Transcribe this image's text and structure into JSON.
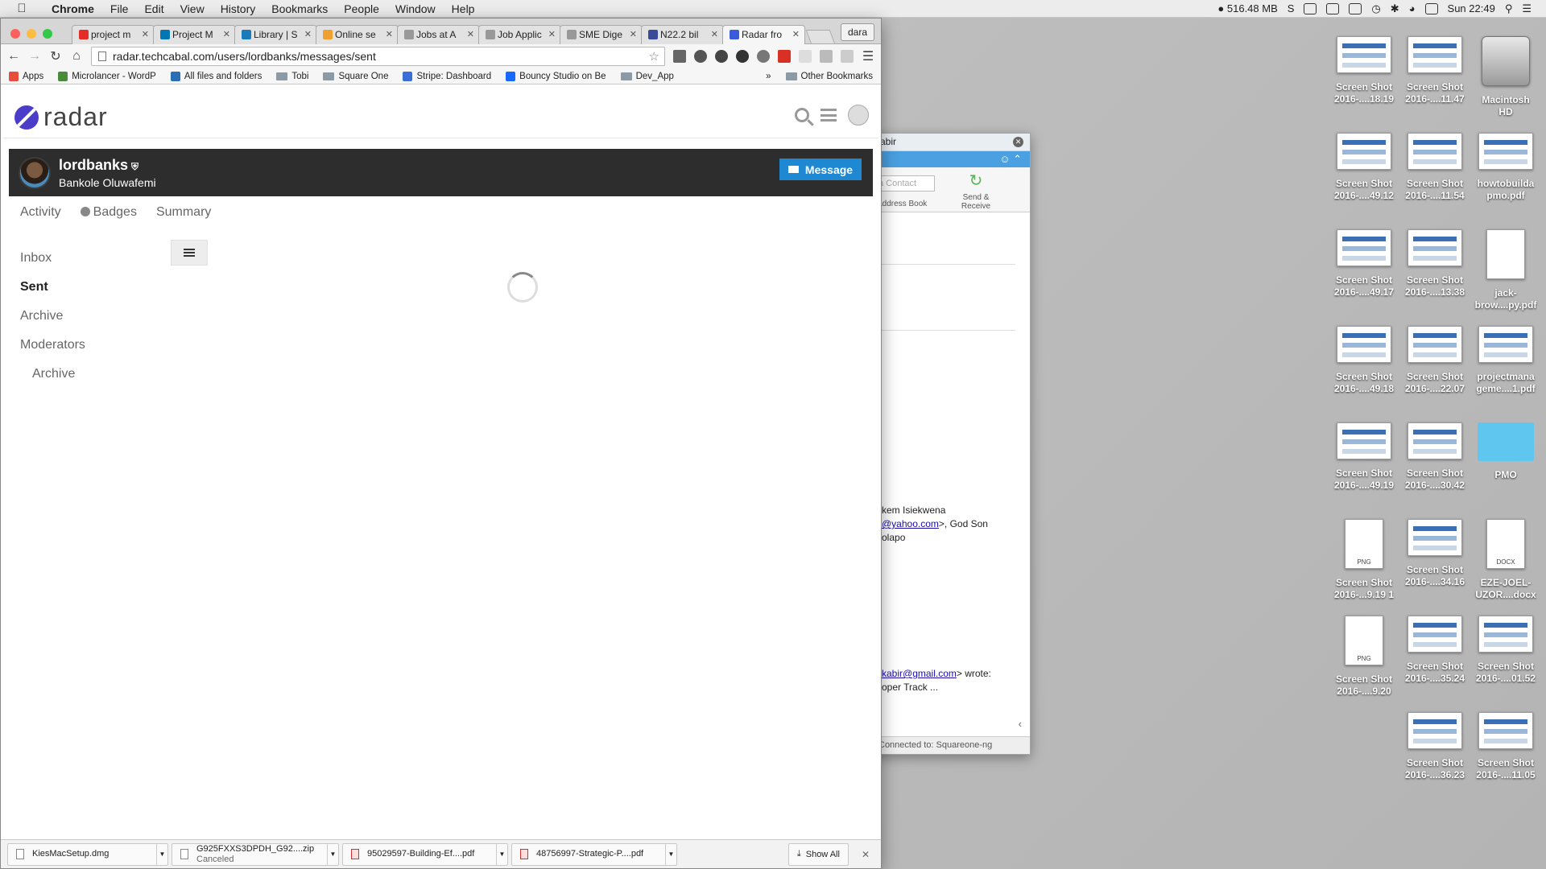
{
  "menubar": {
    "app": "Chrome",
    "items": [
      "File",
      "Edit",
      "View",
      "History",
      "Bookmarks",
      "People",
      "Window",
      "Help"
    ],
    "memory": "516.48 MB",
    "clock": "Sun 22:49"
  },
  "browser": {
    "profile": "dara",
    "tabs": [
      {
        "label": "project m",
        "icon": "youtube-icon",
        "color": "#e52d27"
      },
      {
        "label": "Project M",
        "icon": "linkedin-icon",
        "color": "#0077b5"
      },
      {
        "label": "Library | S",
        "icon": "scribd-icon",
        "color": "#1a7bba"
      },
      {
        "label": "Online se",
        "icon": "loading-icon",
        "color": "#f0a030"
      },
      {
        "label": "Jobs at A",
        "icon": "page-icon",
        "color": "#999999"
      },
      {
        "label": "Job Applic",
        "icon": "page-icon",
        "color": "#999999"
      },
      {
        "label": "SME Dige",
        "icon": "page-icon",
        "color": "#999999"
      },
      {
        "label": "N22.2 bil",
        "icon": "sme-icon",
        "color": "#3a4a9a"
      },
      {
        "label": "Radar fro",
        "icon": "radar-icon",
        "color": "#3b5bdb"
      }
    ],
    "url": "radar.techcabal.com/users/lordbanks/messages/sent",
    "bookmarks": [
      {
        "label": "Apps",
        "icon": "apps-icon",
        "color": "#e74c3c"
      },
      {
        "label": "Microlancer - WordP",
        "icon": "microlancer-icon",
        "color": "#4a8c3c"
      },
      {
        "label": "All files and folders",
        "icon": "box-icon",
        "color": "#2a6fb5"
      },
      {
        "label": "Tobi",
        "icon": "folder-icon",
        "color": "#8c9aa6"
      },
      {
        "label": "Square One",
        "icon": "folder-icon",
        "color": "#8c9aa6"
      },
      {
        "label": "Stripe: Dashboard",
        "icon": "stripe-icon",
        "color": "#3a6fd8"
      },
      {
        "label": "Bouncy Studio on Be",
        "icon": "behance-icon",
        "color": "#1769ff"
      },
      {
        "label": "Dev_App",
        "icon": "folder-icon",
        "color": "#8c9aa6"
      }
    ],
    "other_bookmarks": "Other Bookmarks"
  },
  "radar": {
    "logo": "radar",
    "username": "lordbanks",
    "fullname": "Bankole Oluwafemi",
    "message_button": "Message",
    "subnav": [
      "Activity",
      "Badges",
      "Summary"
    ],
    "folders": [
      "Inbox",
      "Sent",
      "Archive",
      "Moderators",
      "Archive"
    ],
    "active_folder": "Sent",
    "accent": "#1e88d2"
  },
  "downloads": {
    "items": [
      {
        "name": "KiesMacSetup.dmg",
        "status": ""
      },
      {
        "name": "G925FXXS3DPDH_G92....zip",
        "status": "Canceled"
      },
      {
        "name": "95029597-Building-Ef....pdf",
        "status": ""
      },
      {
        "name": "48756997-Strategic-P....pdf",
        "status": ""
      }
    ],
    "show_all": "Show All"
  },
  "mail_window": {
    "search": "abir",
    "contact_placeholder": "a Contact",
    "address_book": "Address Book",
    "send_receive": "Send & Receive",
    "line1": "kem Isiekwena",
    "line2_link": "@yahoo.com",
    "line2_rest": ">, God Son",
    "line3": "olapo",
    "line4_link": "kabir@gmail.com",
    "line4_rest": "> wrote:",
    "line5": "oper Track ...",
    "status": "Connected to: Squareone-ng"
  },
  "desktop": [
    {
      "label": "Screen Shot\n2016-....18.19",
      "kind": "shot"
    },
    {
      "label": "Screen Shot\n2016-....11.47",
      "kind": "shot"
    },
    {
      "label": "Macintosh\nHD",
      "kind": "hd"
    },
    {
      "label": "Screen Shot\n2016-....49.12",
      "kind": "shot"
    },
    {
      "label": "Screen Shot\n2016-....11.54",
      "kind": "shot"
    },
    {
      "label": "howtobuilda\npmo.pdf",
      "kind": "shot"
    },
    {
      "label": "Screen Shot\n2016-....49.17",
      "kind": "shot"
    },
    {
      "label": "Screen Shot\n2016-....13.38",
      "kind": "shot"
    },
    {
      "label": "jack-\nbrow....py.pdf",
      "kind": "doc"
    },
    {
      "label": "Screen Shot\n2016-....49.18",
      "kind": "shot"
    },
    {
      "label": "Screen Shot\n2016-....22.07",
      "kind": "shot"
    },
    {
      "label": "projectmana\ngeme....1.pdf",
      "kind": "shot"
    },
    {
      "label": "Screen Shot\n2016-....49.19",
      "kind": "shot"
    },
    {
      "label": "Screen Shot\n2016-....30.42",
      "kind": "shot"
    },
    {
      "label": "PMO",
      "kind": "folder"
    },
    {
      "label": "Screen Shot\n2016-...9.19 1",
      "kind": "png",
      "tag": "PNG"
    },
    {
      "label": "Screen Shot\n2016-....34.16",
      "kind": "shot"
    },
    {
      "label": "EZE-JOEL-\nUZOR....docx",
      "kind": "docx",
      "tag": "DOCX"
    },
    {
      "label": "Screen Shot\n2016-....9.20",
      "kind": "png",
      "tag": "PNG"
    },
    {
      "label": "Screen Shot\n2016-....35.24",
      "kind": "shot"
    },
    {
      "label": "Screen Shot\n2016-....01.52",
      "kind": "shot"
    },
    {
      "label": "",
      "kind": "empty"
    },
    {
      "label": "Screen Shot\n2016-....36.23",
      "kind": "shot"
    },
    {
      "label": "Screen Shot\n2016-....11.05",
      "kind": "shot"
    }
  ]
}
